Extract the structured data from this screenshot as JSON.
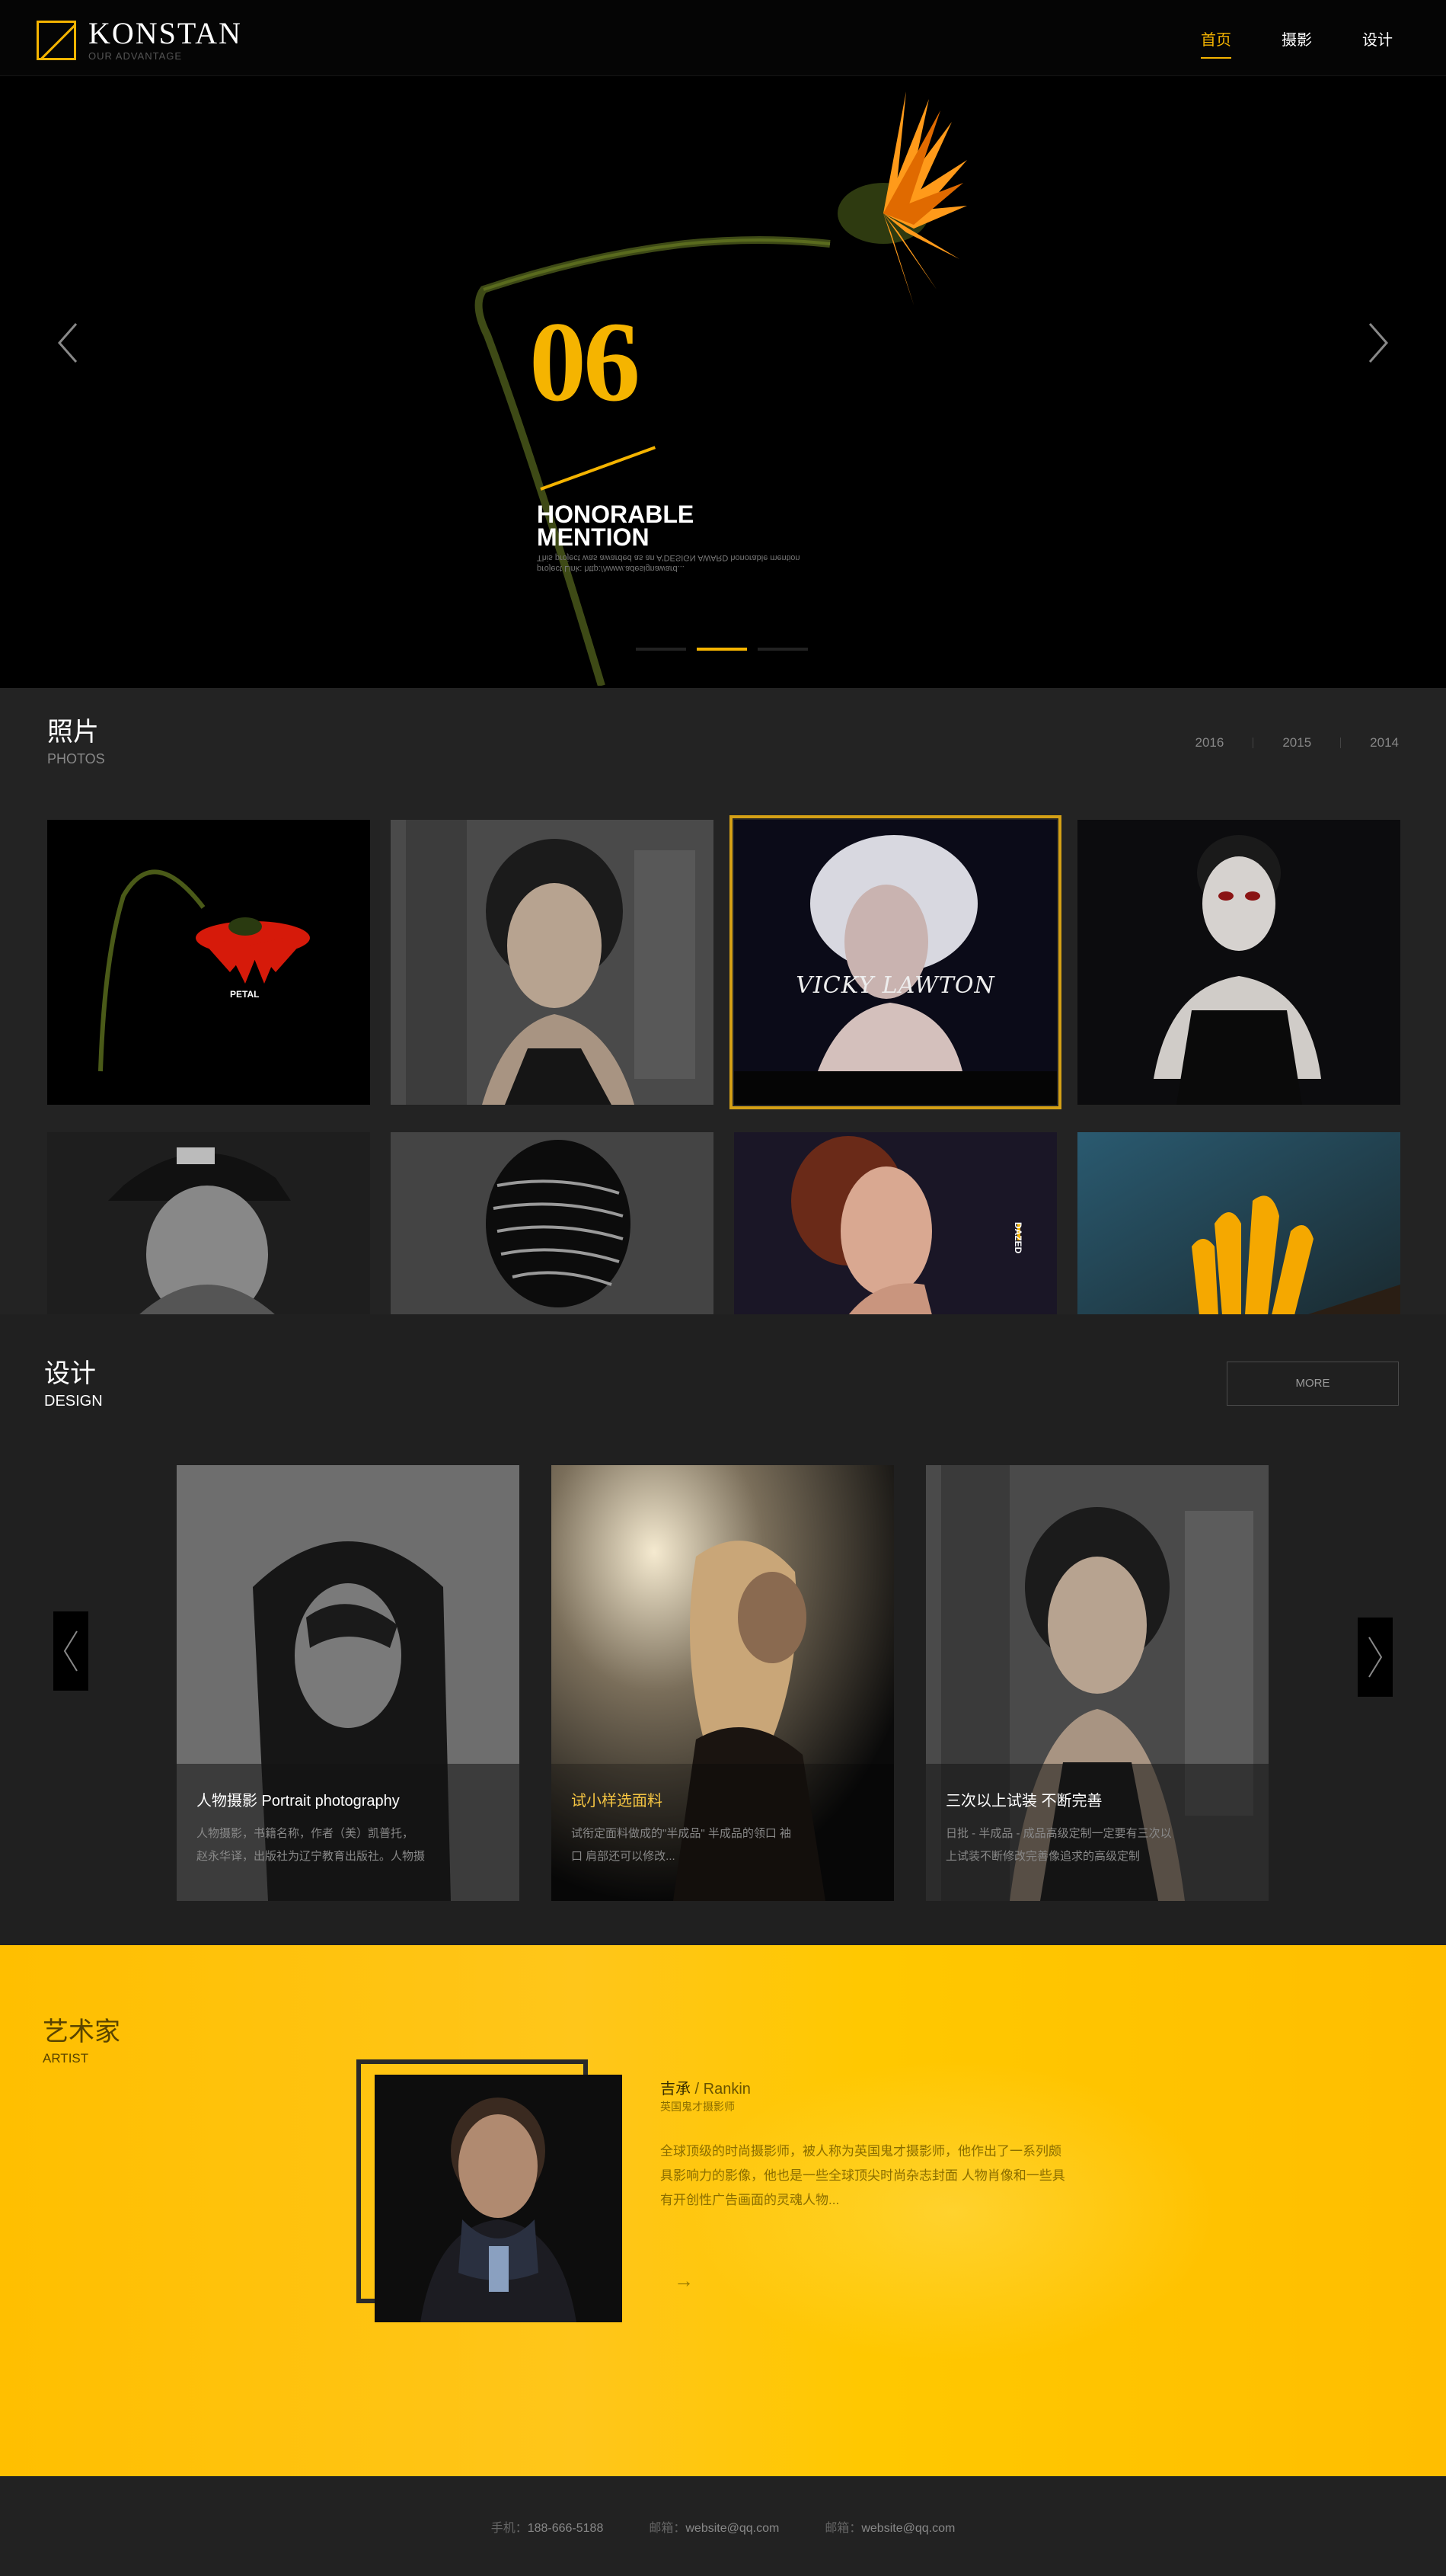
{
  "header": {
    "logo_name": "KONSTAN",
    "logo_sub": "OUR ADVANTAGE",
    "nav": [
      {
        "label": "首页",
        "active": true
      },
      {
        "label": "摄影",
        "active": false
      },
      {
        "label": "设计",
        "active": false
      }
    ]
  },
  "hero": {
    "number": "06",
    "title": "HONORABLE MENTION",
    "caption_line1": "This project was awarded as an A'DESIGN AWARD honorable mention",
    "caption_line2": "project Link: http://www.adesignaward...",
    "slides": 3,
    "active_slide": 2,
    "accent": "#f5b400"
  },
  "photos": {
    "title_cn": "照片",
    "title_en": "PHOTOS",
    "years": [
      "2016",
      "2015",
      "2014"
    ],
    "tiles": [
      {
        "name": "red-flower",
        "tag": "PETAL"
      },
      {
        "name": "woman-portrait"
      },
      {
        "name": "vicky-lawton",
        "label": "VICKY LAWTON",
        "selected": true
      },
      {
        "name": "painted-face"
      },
      {
        "name": "cap-man"
      },
      {
        "name": "wrapped-face"
      },
      {
        "name": "redhead-profile",
        "tag": "DAZED"
      },
      {
        "name": "yellow-flower"
      }
    ]
  },
  "design": {
    "title_cn": "设计",
    "title_en": "DESIGN",
    "more": "MORE",
    "cards": [
      {
        "title": "人物摄影 Portrait photography",
        "line1": "人物摄影，书籍名称，作者（美）凯普托，",
        "line2": "赵永华译，出版社为辽宁教育出版社。人物摄",
        "gold": false
      },
      {
        "title": "试小样选面料",
        "line1": "试衔定面料做成的\"半成品\" 半成品的领口 袖",
        "line2": "口 肩部还可以修改...",
        "gold": true
      },
      {
        "title": "三次以上试装 不断完善",
        "line1": "日批 - 半成品 - 成品高级定制一定要有三次以",
        "line2": "上试装不断修改完善像追求的高级定制",
        "gold": false
      }
    ]
  },
  "artist": {
    "title_cn": "艺术家",
    "title_en": "ARTIST",
    "name_cn": "吉承",
    "name_en": " / Rankin",
    "role": "英国鬼才摄影师",
    "desc": "全球顶级的时尚摄影师，被人称为英国鬼才摄影师，他作出了一系列颇具影响力的影像，他也是一些全球顶尖时尚杂志封面 人物肖像和一些具有开创性广告画面的灵魂人物...",
    "arrow": "→"
  },
  "footer": {
    "phone_label": "手机：",
    "phone": "188-666-5188",
    "email1_label": "邮箱：",
    "email1": "website@qq.com",
    "email2_label": "邮箱：",
    "email2": "website@qq.com"
  }
}
